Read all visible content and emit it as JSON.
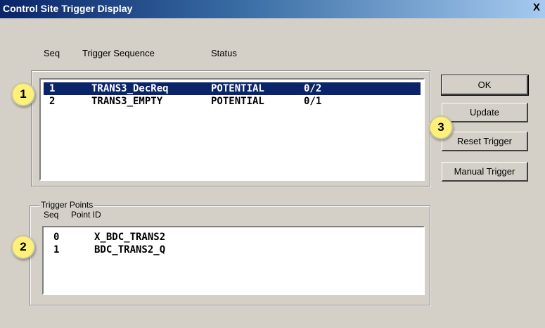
{
  "window": {
    "title": "Control Site Trigger Display",
    "close": "X"
  },
  "sequence_headers": {
    "seq": "Seq",
    "trigger_sequence": "Trigger Sequence",
    "status": "Status"
  },
  "sequence_rows": [
    {
      "seq": "1",
      "name": "TRANS3_DecReq",
      "status": "POTENTIAL",
      "ratio": "0/2",
      "selected": true
    },
    {
      "seq": "2",
      "name": "TRANS3_EMPTY",
      "status": "POTENTIAL",
      "ratio": "0/1",
      "selected": false
    }
  ],
  "trigger_points": {
    "legend": "Trigger Points",
    "headers": {
      "seq": "Seq",
      "point_id": "Point ID"
    },
    "rows": [
      {
        "seq": "0",
        "point_id": "X_BDC_TRANS2"
      },
      {
        "seq": "1",
        "point_id": "BDC_TRANS2_Q"
      }
    ]
  },
  "buttons": {
    "ok": "OK",
    "update": "Update",
    "reset": "Reset Trigger",
    "manual": "Manual Trigger"
  },
  "callouts": [
    "1",
    "2",
    "3"
  ],
  "colors": {
    "selection": "#0a246a",
    "callout": "#fff07a",
    "dialog": "#d4d0c8"
  }
}
